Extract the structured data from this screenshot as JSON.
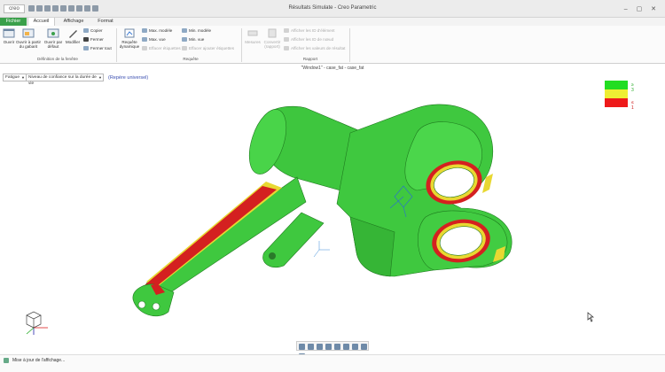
{
  "window": {
    "logo": "creo",
    "title": "Résultats Simulate - Creo Parametric",
    "controls": "– ▢ ✕"
  },
  "tabs": [
    {
      "label": "Fichier"
    },
    {
      "label": "Accueil"
    },
    {
      "label": "Affichage"
    },
    {
      "label": "Format"
    }
  ],
  "ribbon": {
    "window_group": {
      "label": "Définition de la fenêtre",
      "ouvrir": "Ouvrir",
      "ouvrir_partir": "Ouvrir à partir du gabarit",
      "ouvrir_defaut": "Ouvrir par défaut",
      "modifier": "Modifier",
      "copier": "Copier",
      "fermer": "Fermer",
      "fermer_tout": "Fermer tout"
    },
    "query_group": {
      "label": "Requête",
      "requete": "Requête dynamique",
      "max_modele": "Max. modèle",
      "max_vue": "Max. vue",
      "effacer_etiquettes": "Effacer étiquettes",
      "min_modele": "Min. modèle",
      "min_vue": "Min. vue",
      "effacer_ajouter": "Effacer ajouter étiquettes"
    },
    "report_group": {
      "label": "Rapport",
      "mesures": "Mesures",
      "convertir": "Convertir (rapport)",
      "afficher_elements": "Afficher les ID d'élément",
      "afficher_noeuds": "Afficher les ID de nœud",
      "afficher_valeurs": "Afficher les valeurs de résultat"
    }
  },
  "viewer": {
    "window_title": "\"Window1\" - case_fat - case_fat",
    "result_type": "Fatigue",
    "quantity": "Niveau de confiance sur la durée de vie",
    "reference": "(Repère universel)"
  },
  "legend": {
    "colors": [
      "#22dd22",
      "#eeee33",
      "#ee1a1a"
    ],
    "labels": [
      "≥ 3",
      "",
      "≤ 1"
    ]
  },
  "status": {
    "text": "Mise à jour de l'affichage..."
  }
}
